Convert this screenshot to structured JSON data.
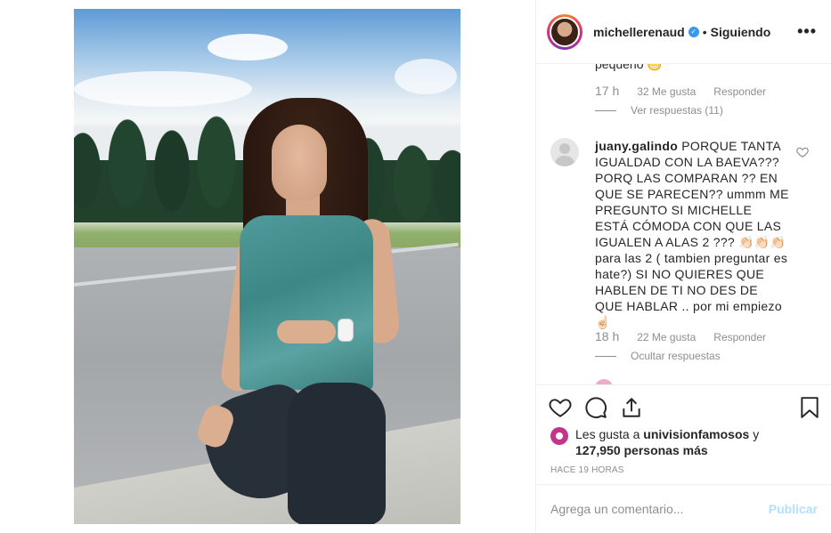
{
  "post": {
    "image_alt": "photo"
  },
  "header": {
    "username": "michellerenaud",
    "verified_mark": "✓",
    "separator": "•",
    "follow_status": "Siguiendo",
    "more": "•••"
  },
  "comments": {
    "previous": {
      "partial_text": "pequeño 😁",
      "time": "17 h",
      "likes": "32 Me gusta",
      "reply": "Responder",
      "view_replies": "Ver respuestas (11)"
    },
    "main": {
      "username": "juany.galindo",
      "text": "PORQUE TANTA IGUALDAD CON LA BAEVA??? PORQ LAS COMPARAN ?? EN QUE SE PARECEN?? ummm ME PREGUNTO SI MICHELLE ESTÁ CÓMODA CON QUE LAS IGUALEN A ALAS 2 ??? 👏🏻👏🏻👏🏻 para las 2 ( tambien preguntar es hate?) SI NO QUIERES QUE HABLEN DE TI NO DES DE QUE HABLAR .. por mi empiezo ☝🏻",
      "time": "18 h",
      "likes": "22 Me gusta",
      "reply": "Responder",
      "hide_replies": "Ocultar respuestas"
    }
  },
  "likes": {
    "prefix": "Les gusta a ",
    "user": "univisionfamosos",
    "middle": " y ",
    "count": "127,950 personas más"
  },
  "age": "HACE 19 HORAS",
  "comment_box": {
    "placeholder": "Agrega un comentario...",
    "publish": "Publicar"
  },
  "colors": {
    "verified": "#3897f0",
    "publish_disabled": "#b2dffc",
    "secondary_text": "#8e8e8e"
  }
}
